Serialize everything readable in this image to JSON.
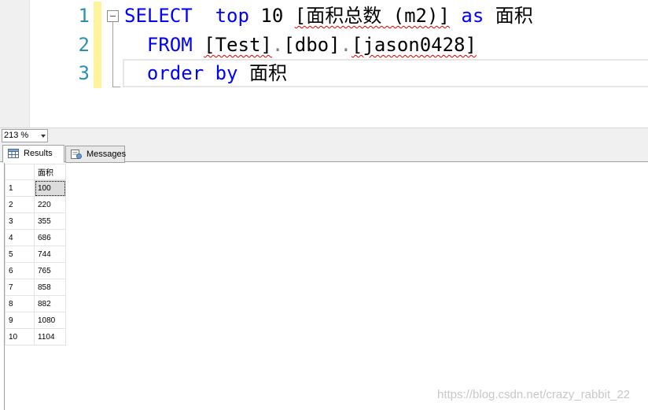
{
  "editor": {
    "line_numbers": [
      "1",
      "2",
      "3"
    ],
    "line1": {
      "kw_select": "SELECT",
      "sp1": "  ",
      "kw_top": "top",
      "num": " 10 ",
      "col": "[面积总数 (m2)]",
      "sp2": " ",
      "kw_as": "as",
      "alias": " 面积"
    },
    "line2": {
      "indent": "  ",
      "kw_from": "FROM",
      "sp": " ",
      "db": "[Test]",
      "dot1": ".",
      "schema": "[dbo]",
      "dot2": ".",
      "table": "[jason0428]"
    },
    "line3": {
      "indent": "  ",
      "kw_order": "order",
      "sp": " ",
      "kw_by": "by",
      "col": " 面积"
    }
  },
  "zoom": {
    "value": "213 %"
  },
  "tabs": [
    {
      "label": "Results",
      "icon": "grid-icon"
    },
    {
      "label": "Messages",
      "icon": "messages-icon"
    }
  ],
  "grid": {
    "header": "面积",
    "rows": [
      {
        "num": "1",
        "val": "100"
      },
      {
        "num": "2",
        "val": "220"
      },
      {
        "num": "3",
        "val": "355"
      },
      {
        "num": "4",
        "val": "686"
      },
      {
        "num": "5",
        "val": "744"
      },
      {
        "num": "6",
        "val": "765"
      },
      {
        "num": "7",
        "val": "858"
      },
      {
        "num": "8",
        "val": "882"
      },
      {
        "num": "9",
        "val": "1080"
      },
      {
        "num": "10",
        "val": "1104"
      }
    ]
  },
  "watermark": "https://blog.csdn.net/crazy_rabbit_22",
  "colors": {
    "keyword": "#0000ff",
    "line_number": "#2b91af",
    "change_bar": "#fff49c",
    "squiggle": "#e00000"
  }
}
